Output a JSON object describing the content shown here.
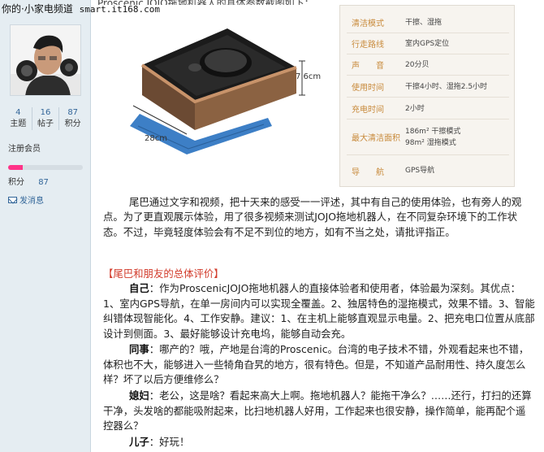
{
  "watermark": {
    "site": "你的·小家电频道",
    "url": "smart.it168.com"
  },
  "sidebar": {
    "stats": [
      {
        "value": "4",
        "label": "主题"
      },
      {
        "value": "16",
        "label": "帖子"
      },
      {
        "value": "87",
        "label": "积分"
      }
    ],
    "member_level": "注册会员",
    "level_progress": 0.2,
    "score_label": "积分",
    "score_value": "87",
    "message_link": "发消息"
  },
  "top_caption": "Proscenic JOJO拖地机器人的具体参数截图如下：",
  "product": {
    "dim_height": "7.6cm",
    "dim_length": "28cm",
    "accent_color": "#c88a3b"
  },
  "specs": [
    {
      "label": "清洁模式",
      "value": "干擦、湿拖"
    },
    {
      "label": "行走路线",
      "value": "室内GPS定位"
    },
    {
      "label": "声　　音",
      "value": "20分贝"
    },
    {
      "label": "使用时间",
      "value": "干擦4小时、湿拖2.5小时"
    },
    {
      "label": "充电时间",
      "value": "2小时"
    },
    {
      "label": "最大清洁面积",
      "value": "186m² 干擦模式",
      "value2": "98m² 湿拖模式"
    },
    {
      "label": "导　　航",
      "value": "GPS导航"
    }
  ],
  "article": {
    "intro": "尾巴通过文字和视频，把十天来的感受一一评述，其中有自己的使用体验，也有旁人的观点。为了更直观展示体验，用了很多视频来测试JOJO拖地机器人，在不同复杂环境下的工作状态。不过，毕竟轻度体验会有不足不到位的地方，如有不当之处，请批评指正。",
    "section_title": "【尾巴和朋友的总体评价】",
    "reviews": [
      {
        "speaker": "自己",
        "text": "：作为ProscenicJOJO拖地机器人的直接体验者和使用者，体验最为深刻。其优点：1、室内GPS导航，在单一房间内可以实现全覆盖。2、独居特色的湿拖模式，效果不错。3、智能纠错体现智能化。4、工作安静。建议：1、在主机上能够直观显示电量。2、把充电口位置从底部设计到侧面。3、最好能够设计充电坞，能够自动会充。"
      },
      {
        "speaker": "同事",
        "text": "：哪产的？哦，产地是台湾的Proscenic。台湾的电子技术不错，外观看起来也不错，体积也不大，能够进入一些犄角旮旯的地方，很有特色。但是，不知道产品耐用性、持久度怎么样？坏了以后方便维修么？"
      },
      {
        "speaker": "媳妇",
        "text": "：老公，这是啥？看起来高大上啊。拖地机器人？能拖干净么？……还行，打扫的还算干净，头发啥的都能吸附起来，比扫地机器人好用，工作起来也很安静，操作简单，能再配个遥控器么？"
      },
      {
        "speaker": "儿子",
        "text": "：好玩！"
      }
    ]
  }
}
